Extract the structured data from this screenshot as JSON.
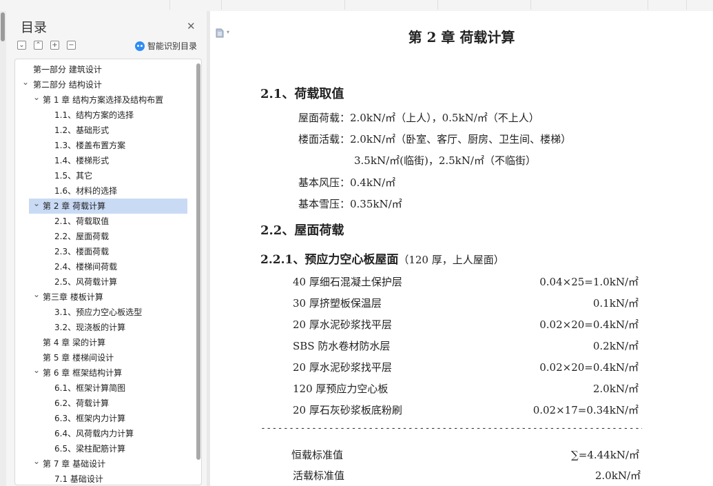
{
  "toc": {
    "title": "目录",
    "smart_label": "智能识别目录",
    "tools": [
      "⌄",
      "⌃",
      "+",
      "−"
    ],
    "items": [
      {
        "label": "第一部分  建筑设计",
        "level": 0,
        "expand": "none"
      },
      {
        "label": "第二部分  结构设计",
        "level": 0,
        "expand": "open"
      },
      {
        "label": "第 1 章  结构方案选择及结构布置",
        "level": 1,
        "expand": "open"
      },
      {
        "label": "1.1、结构方案的选择",
        "level": 2,
        "expand": "none"
      },
      {
        "label": "1.2、基础形式",
        "level": 2,
        "expand": "none"
      },
      {
        "label": "1.3、楼盖布置方案",
        "level": 2,
        "expand": "none"
      },
      {
        "label": "1.4、楼梯形式",
        "level": 2,
        "expand": "none"
      },
      {
        "label": "1.5、其它",
        "level": 2,
        "expand": "none"
      },
      {
        "label": "1.6、材料的选择",
        "level": 2,
        "expand": "none"
      },
      {
        "label": "第 2 章  荷载计算",
        "level": 1,
        "expand": "open",
        "selected": true
      },
      {
        "label": "2.1、荷载取值",
        "level": 2,
        "expand": "none"
      },
      {
        "label": "2.2、屋面荷载",
        "level": 2,
        "expand": "none"
      },
      {
        "label": "2.3、楼面荷载",
        "level": 2,
        "expand": "none"
      },
      {
        "label": "2.4、楼梯间荷载",
        "level": 2,
        "expand": "none"
      },
      {
        "label": "2.5、风荷载计算",
        "level": 2,
        "expand": "none"
      },
      {
        "label": "第三章  楼板计算",
        "level": 1,
        "expand": "open"
      },
      {
        "label": "3.1、预应力空心板选型",
        "level": 2,
        "expand": "none"
      },
      {
        "label": "3.2、现浇板的计算",
        "level": 2,
        "expand": "none"
      },
      {
        "label": "第 4 章    梁的计算",
        "level": 1,
        "expand": "none"
      },
      {
        "label": "第 5 章  楼梯间设计",
        "level": 1,
        "expand": "none"
      },
      {
        "label": "第 6 章  框架结构计算",
        "level": 1,
        "expand": "open"
      },
      {
        "label": "6.1、框架计算简图",
        "level": 2,
        "expand": "none"
      },
      {
        "label": "6.2、荷载计算",
        "level": 2,
        "expand": "none"
      },
      {
        "label": "6.3、框架内力计算",
        "level": 2,
        "expand": "none"
      },
      {
        "label": "6.4、风荷载内力计算",
        "level": 2,
        "expand": "none"
      },
      {
        "label": "6.5、梁柱配筋计算",
        "level": 2,
        "expand": "none"
      },
      {
        "label": "第 7 章    基础设计",
        "level": 1,
        "expand": "open"
      },
      {
        "label": "7.1    基础设计",
        "level": 2,
        "expand": "none"
      }
    ]
  },
  "doc": {
    "chapter_title": "第 2 章  荷载计算",
    "sec21_title": "2.1、荷载取值",
    "roof_load": "屋面荷载：2.0kN/㎡（上人），0.5kN/㎡（不上人）",
    "floor_live": "楼面活载：2.0kN/㎡（卧室、客厅、厨房、卫生间、楼梯）",
    "floor_live2": "3.5kN/㎡(临街)，2.5kN/㎡（不临街）",
    "wind": "基本风压：0.4kN/㎡",
    "snow": "基本雪压：0.35kN/㎡",
    "sec22_title": "2.2、屋面荷载",
    "sec221_title": "2.2.1、预应力空心板屋面",
    "sec221_sub": "（120 厚，上人屋面）",
    "layers": [
      {
        "name": "40 厚细石混凝土保护层",
        "value": "0.04×25=1.0kN/㎡"
      },
      {
        "name": "30 厚挤塑板保温层",
        "value": "0.1kN/㎡"
      },
      {
        "name": "20 厚水泥砂浆找平层",
        "value": "0.02×20=0.4kN/㎡"
      },
      {
        "name": "SBS 防水卷材防水层",
        "value": "0.2kN/㎡"
      },
      {
        "name": "20 厚水泥砂浆找平层",
        "value": "0.02×20=0.4kN/㎡"
      },
      {
        "name": "120 厚预应力空心板",
        "value": "2.0kN/㎡"
      },
      {
        "name": "20 厚石灰砂浆板底粉刷",
        "value": "0.02×17=0.34kN/㎡"
      }
    ],
    "dashes": "--------------------------------------------------------------------------------",
    "dead_label": "恒载标准值",
    "dead_value": "∑=4.44kN/㎡",
    "live_label": "活载标准值",
    "live_value": "2.0kN/㎡"
  }
}
